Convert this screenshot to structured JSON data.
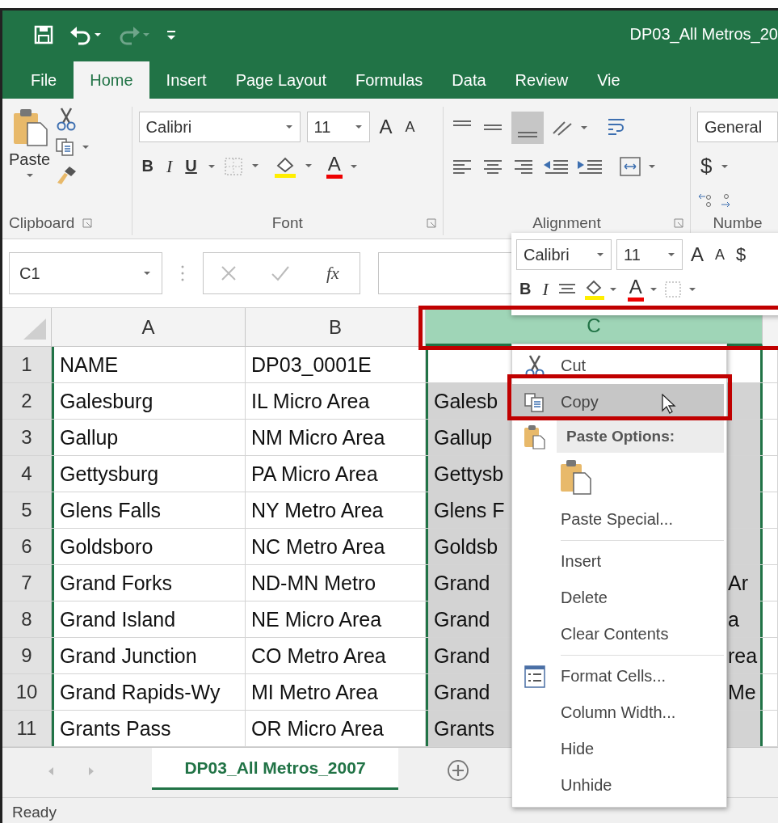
{
  "title_bar": {
    "title": "DP03_All Metros_20"
  },
  "tabs": [
    {
      "label": "File",
      "selected": false
    },
    {
      "label": "Home",
      "selected": true
    },
    {
      "label": "Insert",
      "selected": false
    },
    {
      "label": "Page Layout",
      "selected": false
    },
    {
      "label": "Formulas",
      "selected": false
    },
    {
      "label": "Data",
      "selected": false
    },
    {
      "label": "Review",
      "selected": false
    },
    {
      "label": "Vie",
      "selected": false
    }
  ],
  "ribbon": {
    "clipboard": {
      "label": "Clipboard",
      "paste": "Paste"
    },
    "font": {
      "label": "Font",
      "name": "Calibri",
      "size": "11",
      "grow": "A",
      "shrink": "A",
      "bold": "B",
      "italic": "I",
      "underline": "U",
      "font_color_label": "A"
    },
    "alignment": {
      "label": "Alignment"
    },
    "number": {
      "label": "Numbe",
      "format": "General",
      "currency": "$"
    }
  },
  "formula_bar": {
    "name_box": "C1",
    "function_label": "fx"
  },
  "columns": [
    {
      "label": "A",
      "selected": false
    },
    {
      "label": "B",
      "selected": false
    },
    {
      "label": "C",
      "selected": true
    }
  ],
  "rows": [
    {
      "number": "1",
      "a": "NAME",
      "b": "DP03_0001E"
    },
    {
      "number": "2",
      "a": "Galesburg",
      "b": "IL Micro Area",
      "c": "Galesb"
    },
    {
      "number": "3",
      "a": "Gallup",
      "b": "NM Micro Area",
      "c": "Gallup"
    },
    {
      "number": "4",
      "a": "Gettysburg",
      "b": "PA Micro Area",
      "c": "Gettysb"
    },
    {
      "number": "5",
      "a": "Glens Falls",
      "b": "NY Metro Area",
      "c": "Glens F"
    },
    {
      "number": "6",
      "a": "Goldsboro",
      "b": "NC Metro Area",
      "c": "Goldsb"
    },
    {
      "number": "7",
      "a": "Grand Forks",
      "b": "ND-MN Metro",
      "c": "Grand",
      "c_end": "Ar"
    },
    {
      "number": "8",
      "a": "Grand Island",
      "b": "NE Micro Area",
      "c": "Grand",
      "c_end": "a"
    },
    {
      "number": "9",
      "a": "Grand Junction",
      "b": "CO Metro Area",
      "c": "Grand",
      "c_end": "rea"
    },
    {
      "number": "10",
      "a": "Grand Rapids-Wy",
      "b": "MI Metro Area",
      "c": "Grand",
      "c_end": "Me"
    },
    {
      "number": "11",
      "a": "Grants Pass",
      "b": "OR Micro Area",
      "c": "Grants"
    }
  ],
  "sheet_tabs": [
    {
      "label": "DP03_All Metros_2007",
      "selected": true
    }
  ],
  "status_bar": {
    "text": "Ready"
  },
  "mini_toolbar": {
    "font": "Calibri",
    "size": "11",
    "grow": "A",
    "shrink": "A",
    "currency": "$",
    "bold": "B",
    "italic": "I",
    "font_color_label": "A"
  },
  "context_menu": {
    "items": [
      {
        "kind": "cut",
        "label": "Cut",
        "selected": false
      },
      {
        "kind": "copy",
        "label": "Copy",
        "selected": true
      },
      {
        "kind": "header",
        "label": "Paste Options:"
      },
      {
        "kind": "paste-option"
      },
      {
        "kind": "command",
        "label": "Paste Special...",
        "selected": false
      },
      {
        "kind": "separator"
      },
      {
        "kind": "command",
        "label": "Insert",
        "selected": false
      },
      {
        "kind": "command",
        "label": "Delete",
        "selected": false
      },
      {
        "kind": "command",
        "label": "Clear Contents",
        "selected": false
      },
      {
        "kind": "separator"
      },
      {
        "kind": "format",
        "label": "Format Cells...",
        "selected": false
      },
      {
        "kind": "command",
        "label": "Column Width...",
        "selected": false
      },
      {
        "kind": "command",
        "label": "Hide",
        "selected": false
      },
      {
        "kind": "command",
        "label": "Unhide",
        "selected": false
      }
    ]
  }
}
